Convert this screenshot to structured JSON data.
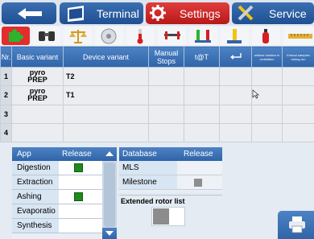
{
  "nav": {
    "terminal": "Terminal",
    "settings": "Settings",
    "service": "Service"
  },
  "toolbar": [
    "puzzle-icon",
    "binoculars-icon",
    "scale-icon",
    "rotor-icon",
    "thermometer-icon",
    "pressure-gauge-icon",
    "test-tubes-icon",
    "pipette-icon",
    "extinguisher-icon",
    "ruler-icon"
  ],
  "table": {
    "headers": [
      "Nr.",
      "Basic variant",
      "Device variant",
      "Manual Stops",
      "t@T",
      "",
      "without rotation in ventilation",
      "Extract samples during run"
    ],
    "rows": [
      {
        "nr": "1",
        "basic_line1": "pyro",
        "basic_line2": "PREP",
        "device": "T2"
      },
      {
        "nr": "2",
        "basic_line1": "pyro",
        "basic_line2": "PREP",
        "device": "T1"
      },
      {
        "nr": "3",
        "basic_line1": "",
        "basic_line2": "",
        "device": ""
      },
      {
        "nr": "4",
        "basic_line1": "",
        "basic_line2": "",
        "device": ""
      }
    ]
  },
  "app_panel": {
    "header_app": "App",
    "header_release": "Release",
    "rows": [
      {
        "name": "Digestion",
        "released": true
      },
      {
        "name": "Extraction",
        "released": false
      },
      {
        "name": "Ashing",
        "released": true
      },
      {
        "name": "Evaporatio",
        "released": false
      },
      {
        "name": "Synthesis",
        "released": false
      }
    ]
  },
  "db_panel": {
    "header_db": "Database",
    "header_release": "Release",
    "rows": [
      {
        "name": "MLS",
        "state": "empty"
      },
      {
        "name": "Milestone",
        "state": "grey"
      }
    ]
  },
  "rotor": {
    "label": "Extended rotor list"
  },
  "colors": {
    "accent_blue": "#2f64a8",
    "active_red": "#d42020",
    "release_green": "#1e8a1e"
  }
}
